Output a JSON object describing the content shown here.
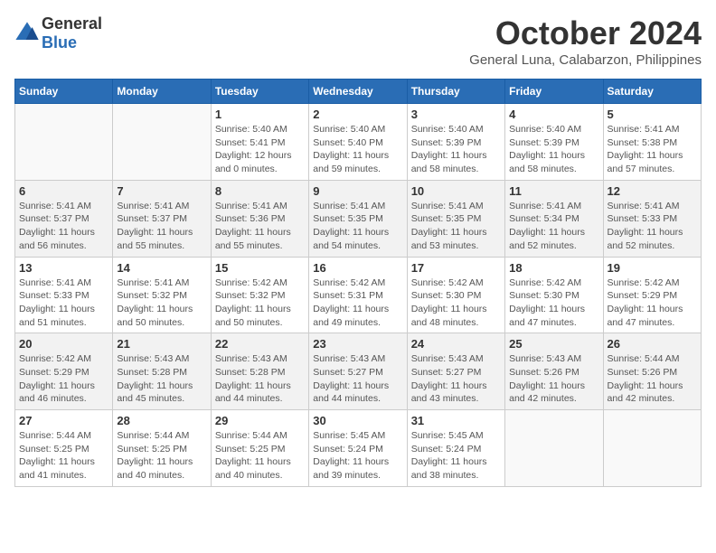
{
  "header": {
    "logo": {
      "general": "General",
      "blue": "Blue"
    },
    "title": "October 2024",
    "location": "General Luna, Calabarzon, Philippines"
  },
  "weekdays": [
    "Sunday",
    "Monday",
    "Tuesday",
    "Wednesday",
    "Thursday",
    "Friday",
    "Saturday"
  ],
  "weeks": [
    [
      {
        "day": "",
        "info": ""
      },
      {
        "day": "",
        "info": ""
      },
      {
        "day": "1",
        "info": "Sunrise: 5:40 AM\nSunset: 5:41 PM\nDaylight: 12 hours and 0 minutes."
      },
      {
        "day": "2",
        "info": "Sunrise: 5:40 AM\nSunset: 5:40 PM\nDaylight: 11 hours and 59 minutes."
      },
      {
        "day": "3",
        "info": "Sunrise: 5:40 AM\nSunset: 5:39 PM\nDaylight: 11 hours and 58 minutes."
      },
      {
        "day": "4",
        "info": "Sunrise: 5:40 AM\nSunset: 5:39 PM\nDaylight: 11 hours and 58 minutes."
      },
      {
        "day": "5",
        "info": "Sunrise: 5:41 AM\nSunset: 5:38 PM\nDaylight: 11 hours and 57 minutes."
      }
    ],
    [
      {
        "day": "6",
        "info": "Sunrise: 5:41 AM\nSunset: 5:37 PM\nDaylight: 11 hours and 56 minutes."
      },
      {
        "day": "7",
        "info": "Sunrise: 5:41 AM\nSunset: 5:37 PM\nDaylight: 11 hours and 55 minutes."
      },
      {
        "day": "8",
        "info": "Sunrise: 5:41 AM\nSunset: 5:36 PM\nDaylight: 11 hours and 55 minutes."
      },
      {
        "day": "9",
        "info": "Sunrise: 5:41 AM\nSunset: 5:35 PM\nDaylight: 11 hours and 54 minutes."
      },
      {
        "day": "10",
        "info": "Sunrise: 5:41 AM\nSunset: 5:35 PM\nDaylight: 11 hours and 53 minutes."
      },
      {
        "day": "11",
        "info": "Sunrise: 5:41 AM\nSunset: 5:34 PM\nDaylight: 11 hours and 52 minutes."
      },
      {
        "day": "12",
        "info": "Sunrise: 5:41 AM\nSunset: 5:33 PM\nDaylight: 11 hours and 52 minutes."
      }
    ],
    [
      {
        "day": "13",
        "info": "Sunrise: 5:41 AM\nSunset: 5:33 PM\nDaylight: 11 hours and 51 minutes."
      },
      {
        "day": "14",
        "info": "Sunrise: 5:41 AM\nSunset: 5:32 PM\nDaylight: 11 hours and 50 minutes."
      },
      {
        "day": "15",
        "info": "Sunrise: 5:42 AM\nSunset: 5:32 PM\nDaylight: 11 hours and 50 minutes."
      },
      {
        "day": "16",
        "info": "Sunrise: 5:42 AM\nSunset: 5:31 PM\nDaylight: 11 hours and 49 minutes."
      },
      {
        "day": "17",
        "info": "Sunrise: 5:42 AM\nSunset: 5:30 PM\nDaylight: 11 hours and 48 minutes."
      },
      {
        "day": "18",
        "info": "Sunrise: 5:42 AM\nSunset: 5:30 PM\nDaylight: 11 hours and 47 minutes."
      },
      {
        "day": "19",
        "info": "Sunrise: 5:42 AM\nSunset: 5:29 PM\nDaylight: 11 hours and 47 minutes."
      }
    ],
    [
      {
        "day": "20",
        "info": "Sunrise: 5:42 AM\nSunset: 5:29 PM\nDaylight: 11 hours and 46 minutes."
      },
      {
        "day": "21",
        "info": "Sunrise: 5:43 AM\nSunset: 5:28 PM\nDaylight: 11 hours and 45 minutes."
      },
      {
        "day": "22",
        "info": "Sunrise: 5:43 AM\nSunset: 5:28 PM\nDaylight: 11 hours and 44 minutes."
      },
      {
        "day": "23",
        "info": "Sunrise: 5:43 AM\nSunset: 5:27 PM\nDaylight: 11 hours and 44 minutes."
      },
      {
        "day": "24",
        "info": "Sunrise: 5:43 AM\nSunset: 5:27 PM\nDaylight: 11 hours and 43 minutes."
      },
      {
        "day": "25",
        "info": "Sunrise: 5:43 AM\nSunset: 5:26 PM\nDaylight: 11 hours and 42 minutes."
      },
      {
        "day": "26",
        "info": "Sunrise: 5:44 AM\nSunset: 5:26 PM\nDaylight: 11 hours and 42 minutes."
      }
    ],
    [
      {
        "day": "27",
        "info": "Sunrise: 5:44 AM\nSunset: 5:25 PM\nDaylight: 11 hours and 41 minutes."
      },
      {
        "day": "28",
        "info": "Sunrise: 5:44 AM\nSunset: 5:25 PM\nDaylight: 11 hours and 40 minutes."
      },
      {
        "day": "29",
        "info": "Sunrise: 5:44 AM\nSunset: 5:25 PM\nDaylight: 11 hours and 40 minutes."
      },
      {
        "day": "30",
        "info": "Sunrise: 5:45 AM\nSunset: 5:24 PM\nDaylight: 11 hours and 39 minutes."
      },
      {
        "day": "31",
        "info": "Sunrise: 5:45 AM\nSunset: 5:24 PM\nDaylight: 11 hours and 38 minutes."
      },
      {
        "day": "",
        "info": ""
      },
      {
        "day": "",
        "info": ""
      }
    ]
  ]
}
